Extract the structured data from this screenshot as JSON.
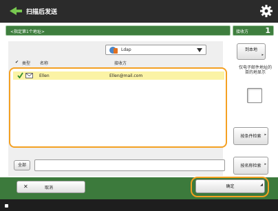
{
  "title_bar": {
    "title": "扫描后发送",
    "app_icon": "scan-send-icon",
    "settings_icon": "gear-icon"
  },
  "header": {
    "breadcrumb": "<指定第1个地址>",
    "recipients_label": "接收方",
    "recipients_count": "1"
  },
  "address_book": {
    "selected": "Ldap",
    "icon": "ldap-server-icon"
  },
  "columns": {
    "type": "类型",
    "name": "名称",
    "destination": "接收方"
  },
  "rows": [
    {
      "checked": true,
      "type_icon": "email-icon",
      "name": "Ellen",
      "destination": "Ellen@mail.com"
    }
  ],
  "side": {
    "list_button": "到本地",
    "email_caption": "仅电子邮件地址的目的地显示",
    "search_start_button": "按条件检索",
    "search_name_button": "按名称检索"
  },
  "search": {
    "all_button": "全部",
    "value": ""
  },
  "footer": {
    "cancel_label": "取消",
    "cancel_icon": "close-icon",
    "ok_label": "确定"
  },
  "colors": {
    "title_bg": "#2b2b2b",
    "accent_green": "#3e7e3e",
    "highlight_orange": "#f4a021",
    "row_selected": "#fbf3a5"
  }
}
